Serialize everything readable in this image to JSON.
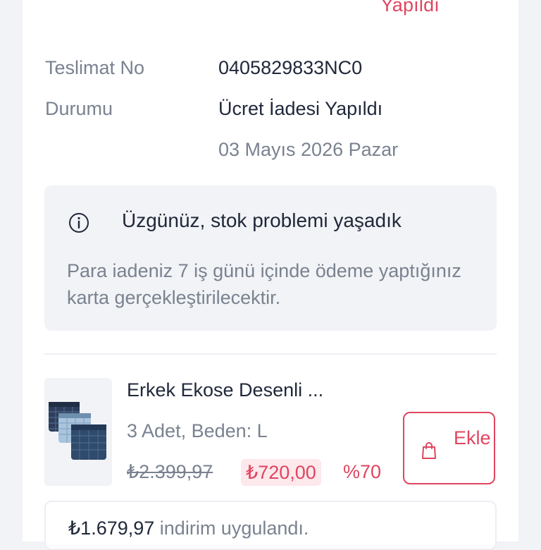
{
  "order": {
    "status_top": "Yapıldı",
    "delivery_label": "Teslimat No",
    "delivery_value": "0405829833NC0",
    "status_label": "Durumu",
    "status_value": "Ücret İadesi Yapıldı",
    "status_date": "03 Mayıs 2026 Pazar"
  },
  "notice": {
    "icon": "info-icon",
    "title": "Üzgünüz, stok problemi yaşadık",
    "description": "Para iadeniz 7 iş günü içinde ödeme yaptığınız karta gerçekleştirilecektir."
  },
  "product": {
    "name": "Erkek Ekose Desenli ...",
    "meta": "3 Adet, Beden: L",
    "old_price": "₺2.399,97",
    "new_price": "₺720,00",
    "discount": "%70",
    "add_label": "Ekle",
    "add_icon": "shopping-bag-icon"
  },
  "saving": {
    "amount": "₺1.679,97",
    "text": "indirim uygulandı."
  },
  "colors": {
    "accent": "#e0455f",
    "text": "#20283a",
    "muted": "#7a8290",
    "panel": "#f2f3f6"
  }
}
